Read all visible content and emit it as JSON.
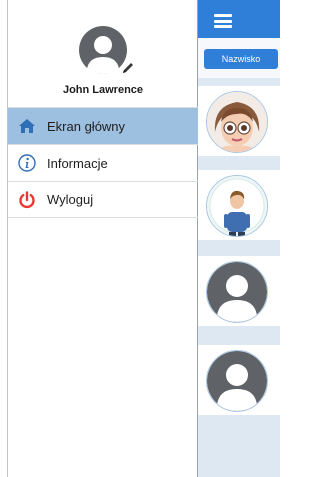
{
  "drawer": {
    "user_name": "John Lawrence",
    "menu": [
      {
        "label": "Ekran główny",
        "icon": "home-icon",
        "active": true
      },
      {
        "label": "Informacje",
        "icon": "info-icon",
        "active": false
      },
      {
        "label": "Wyloguj",
        "icon": "power-icon",
        "active": false
      }
    ]
  },
  "app": {
    "filter_button_label": "Nazwisko",
    "contacts": [
      {
        "avatar": "girl-avatar"
      },
      {
        "avatar": "man-avatar"
      },
      {
        "avatar": "default-avatar"
      },
      {
        "avatar": "default-avatar"
      }
    ]
  },
  "colors": {
    "accent": "#2f7ed8",
    "active_item": "#9dbfe0",
    "power_icon": "#e53935",
    "home_icon": "#2f6fb5"
  }
}
